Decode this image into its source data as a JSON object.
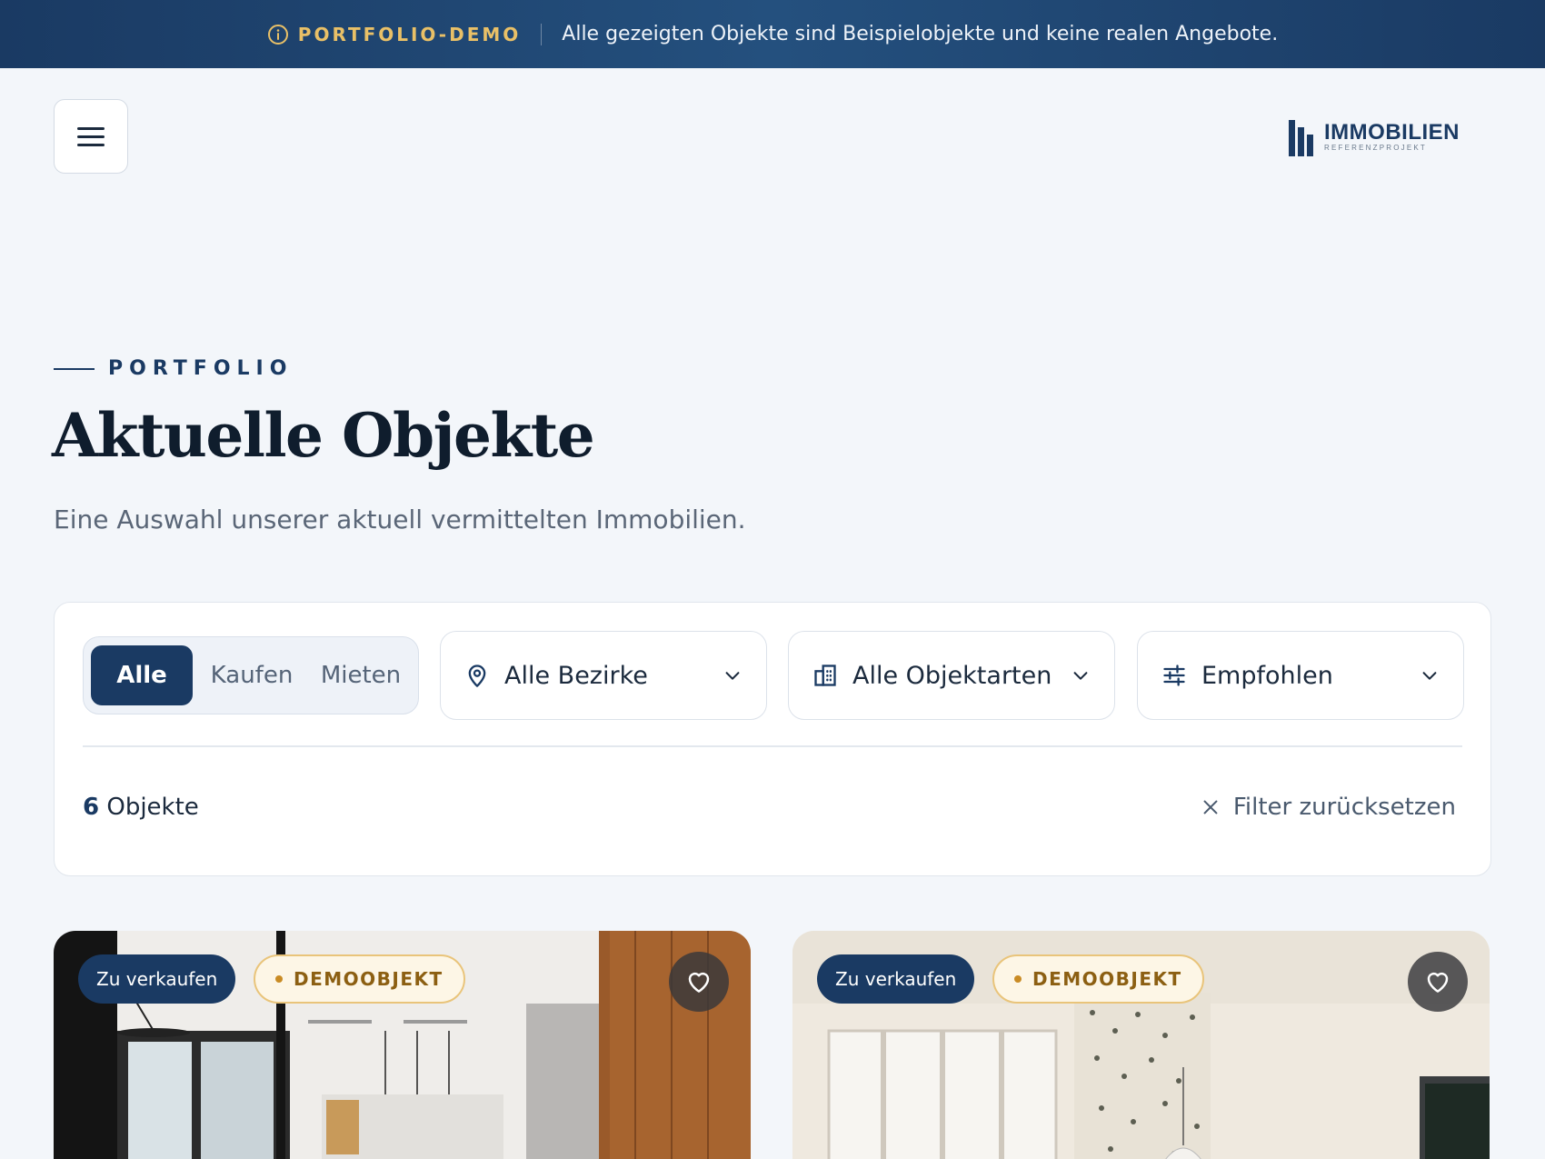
{
  "banner": {
    "tag": "PORTFOLIO-DEMO",
    "message": "Alle gezeigten Objekte sind Beispielobjekte und keine realen Angebote.",
    "icon": "info-icon"
  },
  "header": {
    "menu_icon": "hamburger-menu-icon",
    "logo": {
      "name": "IMMOBILIEN",
      "tagline": "REFERENZPROJEKT"
    }
  },
  "hero": {
    "eyebrow": "PORTFOLIO",
    "title": "Aktuelle Objekte",
    "subtitle": "Eine Auswahl unserer aktuell vermittelten Immobilien."
  },
  "filters": {
    "segments": [
      {
        "label": "Alle",
        "active": true
      },
      {
        "label": "Kaufen",
        "active": false
      },
      {
        "label": "Mieten",
        "active": false
      }
    ],
    "district": {
      "label": "Alle Bezirke",
      "icon": "map-pin-icon"
    },
    "type": {
      "label": "Alle Objektarten",
      "icon": "building-icon"
    },
    "sort": {
      "label": "Empfohlen",
      "icon": "sliders-icon"
    },
    "count": {
      "number": "6",
      "suffix": " Objekte"
    },
    "reset_label": "Filter zurücksetzen"
  },
  "listings": [
    {
      "status": "Zu verkaufen",
      "demo_badge": "DEMOOBJEKT",
      "fav_icon": "heart-icon"
    },
    {
      "status": "Zu verkaufen",
      "demo_badge": "DEMOOBJEKT",
      "fav_icon": "heart-icon"
    }
  ],
  "colors": {
    "primary": "#1a3a63",
    "accent": "#e9c067",
    "background": "#f3f6fa"
  }
}
